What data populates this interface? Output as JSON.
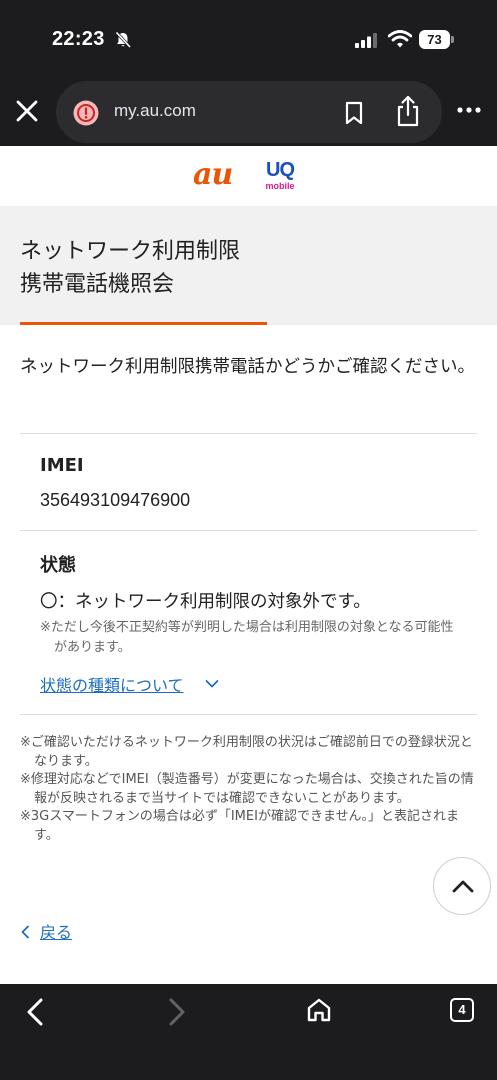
{
  "status_bar": {
    "time": "22:23",
    "battery": "73"
  },
  "browser": {
    "url": "my.au.com"
  },
  "brand": {
    "au": "au",
    "uq": "UQ",
    "uq_sub": "mobile",
    "colors": {
      "au": "#eb5505",
      "uq": "#1a4fc4",
      "uq_sub": "#d61a8a"
    }
  },
  "page": {
    "title_line1": "ネットワーク利用制限",
    "title_line2": "携帯電話機照会",
    "intro": "ネットワーク利用制限携帯電話かどうかご確認ください。",
    "imei_label": "IMEI",
    "imei_value": "356493109476900",
    "status_label": "状態",
    "status_value": "〇：ネットワーク利用制限の対象外です。",
    "status_note": "※ただし今後不正契約等が判明した場合は利用制限の対象となる可能性があります。",
    "types_link": "状態の種類について",
    "notes": [
      "※ご確認いただけるネットワーク利用制限の状況はご確認前日での登録状況となります。",
      "※修理対応などでIMEI（製造番号）が変更になった場合は、交換された旨の情報が反映されるまで当サイトでは確認できないことがあります。",
      "※3Gスマートフォンの場合は必ず「IMEIが確認できません。」と表記されます。"
    ],
    "back": "戻る",
    "accent": "#eb5505",
    "link_color": "#1f6fbf"
  },
  "toolbar": {
    "tabs_count": "4"
  }
}
